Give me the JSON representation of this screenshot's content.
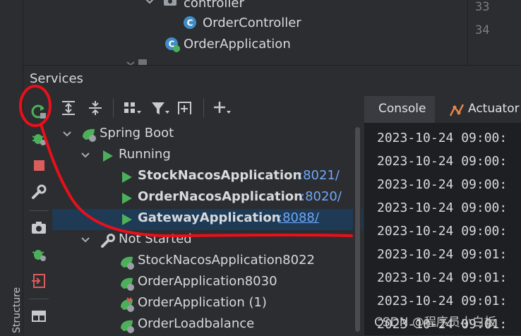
{
  "project_tree": {
    "folder_label": "controller",
    "class_label": "OrderController",
    "app_label": "OrderApplication"
  },
  "gutter": {
    "lines": [
      "33",
      "34"
    ]
  },
  "services": {
    "title": "Services",
    "tree": {
      "root": "Spring Boot",
      "running_group": "Running",
      "running": [
        {
          "name": "StockNacosApplication",
          "port": ":8021/"
        },
        {
          "name": "OrderNacosApplication",
          "port": ":8020/"
        },
        {
          "name": "GatewayApplication",
          "port": ":8088/"
        }
      ],
      "not_started_group": "Not Started",
      "not_started": [
        "StockNacosApplication8022",
        "OrderApplication8030",
        "OrderApplication (1)",
        "OrderLoadbalance"
      ]
    }
  },
  "console": {
    "tabs": [
      "Console",
      "Actuator"
    ],
    "lines": [
      "2023-10-24 09:00:",
      "2023-10-24 09:00:",
      "2023-10-24 09:00:",
      "2023-10-24 09:00:",
      "2023-10-24 09:00:",
      "2023-10-24 09:01:",
      "2023-10-24 09:01:",
      "2023-10-24 09:01:",
      "2023-10-24 09:01:"
    ]
  },
  "left_stripe": {
    "structure_label": "Structure"
  },
  "watermark": "CSDN @程序员小白板",
  "colors": {
    "run_green": "#4cb05a",
    "stop_red": "#db5c5c",
    "link_blue": "#6fa8f7",
    "annotation_red": "#e8101a"
  }
}
